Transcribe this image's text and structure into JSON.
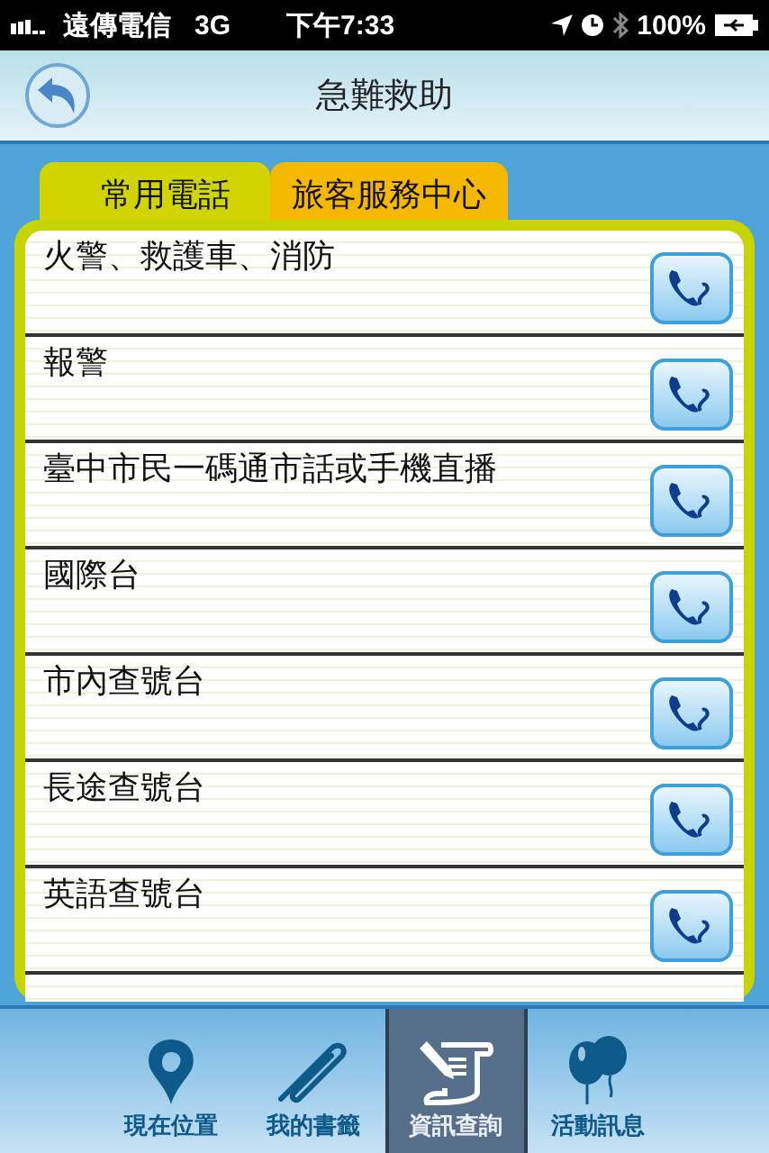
{
  "status_bar": {
    "carrier": "遠傳電信",
    "network": "3G",
    "time": "下午7:33",
    "battery": "100%"
  },
  "nav_bar": {
    "title": "急難救助"
  },
  "tabs": [
    {
      "label": "常用電話",
      "selected": true
    },
    {
      "label": "旅客服務中心",
      "selected": false
    }
  ],
  "rows": [
    {
      "name": "火警、救護車、消防"
    },
    {
      "name": "報警"
    },
    {
      "name": "臺中市民一碼通市話或手機直播"
    },
    {
      "name": "國際台"
    },
    {
      "name": "市內查號台"
    },
    {
      "name": "長途查號台"
    },
    {
      "name": "英語查號台"
    }
  ],
  "tab_bar": [
    {
      "label": "現在位置",
      "kind": "pin",
      "selected": false
    },
    {
      "label": "我的書籤",
      "kind": "clip",
      "selected": false
    },
    {
      "label": "資訊查詢",
      "kind": "doc",
      "selected": true
    },
    {
      "label": "活動訊息",
      "kind": "balloon",
      "selected": false
    }
  ]
}
